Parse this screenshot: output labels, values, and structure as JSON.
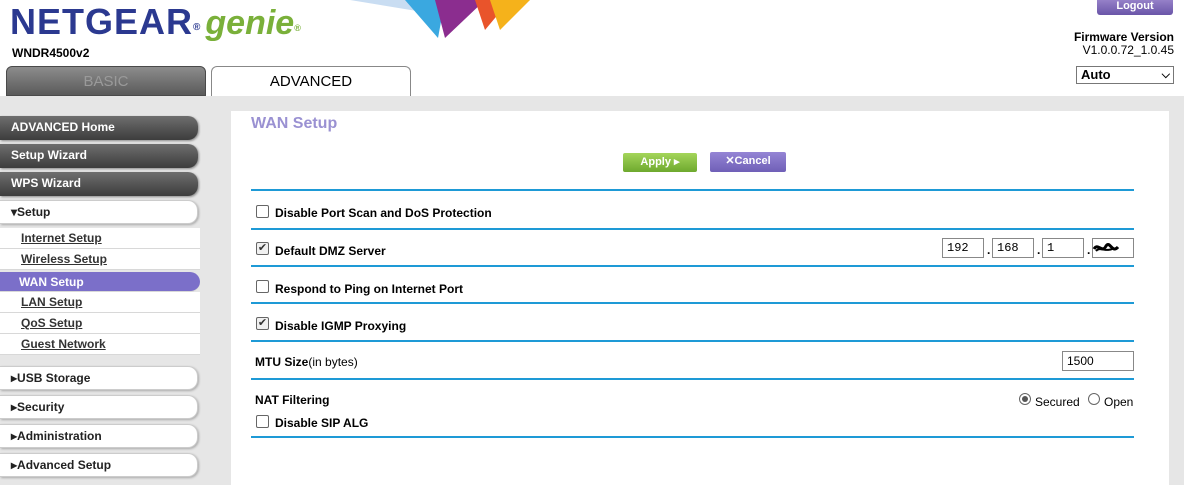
{
  "header": {
    "brand": "NETGEAR",
    "brand_reg": "®",
    "product": "genie",
    "product_reg": "®",
    "model": "WNDR4500v2",
    "logout_label": "Logout",
    "firmware_label": "Firmware Version",
    "firmware_value": "V1.0.0.72_1.0.45",
    "language": "Auto"
  },
  "tabs": {
    "basic": "BASIC",
    "advanced": "ADVANCED"
  },
  "sidebar": {
    "advanced_home": "ADVANCED Home",
    "setup_wizard": "Setup Wizard",
    "wps_wizard": "WPS Wizard",
    "setup": "▾Setup",
    "setup_items": [
      "Internet Setup",
      "Wireless Setup",
      "WAN Setup",
      "LAN Setup",
      "QoS Setup",
      "Guest Network"
    ],
    "usb_storage": "▸USB Storage",
    "security": "▸Security",
    "administration": "▸Administration",
    "advanced_setup": "▸Advanced Setup"
  },
  "main": {
    "title": "WAN Setup",
    "apply_label": "Apply ▸",
    "cancel_label": "✕Cancel",
    "disable_port_scan": "Disable Port Scan and DoS Protection",
    "default_dmz": "Default DMZ Server",
    "dmz_ip": [
      "192",
      "168",
      "1",
      ""
    ],
    "respond_ping": "Respond to Ping on Internet Port",
    "disable_igmp": "Disable IGMP Proxying",
    "mtu_label": "MTU Size",
    "mtu_unit": "(in bytes)",
    "mtu_value": "1500",
    "nat_filtering": "NAT Filtering",
    "nat_secured": "Secured",
    "nat_open": "Open",
    "disable_sip": "Disable SIP ALG",
    "checks": {
      "disable_port_scan": false,
      "default_dmz": true,
      "respond_ping": false,
      "disable_igmp": true,
      "disable_sip": false
    },
    "nat_selected": "Secured"
  },
  "colors": {
    "brand_blue": "#2b3990",
    "genie_green": "#7ab03a",
    "accent_purple": "#7b6fc9",
    "divider_blue": "#1e9ad6"
  }
}
